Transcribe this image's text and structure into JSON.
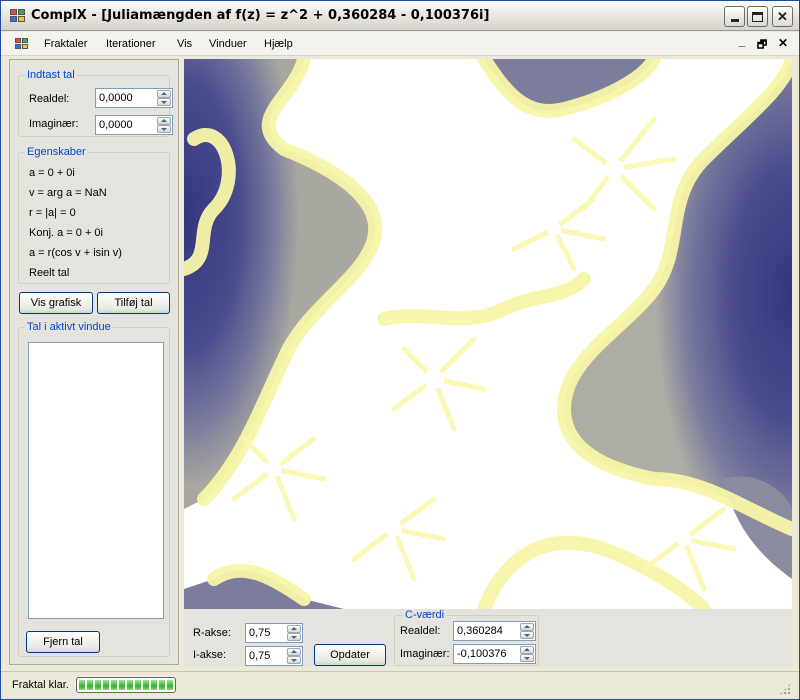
{
  "window": {
    "title": "ComplX - [Juliamængden af f(z) = z^2 + 0,360284 - 0,100376i]",
    "controls": {
      "minimize": "minimize",
      "maximize": "maximize",
      "close": "✕"
    }
  },
  "menu": {
    "items": [
      "Fraktaler",
      "Iterationer",
      "Vis",
      "Vinduer",
      "Hjælp"
    ],
    "mdi": {
      "minimize": "_",
      "restore": "🗗",
      "close": "✕"
    }
  },
  "input_group": {
    "legend": "Indtast tal",
    "real_label": "Realdel:",
    "real_value": "0,0000",
    "imag_label": "Imaginær:",
    "imag_value": "0,0000"
  },
  "properties_group": {
    "legend": "Egenskaber",
    "lines": [
      "a = 0 + 0i",
      "v = arg a = NaN",
      "r = |a| = 0",
      "Konj. a = 0 + 0i",
      "a = r(cos v + isin v)",
      "Reelt tal"
    ]
  },
  "buttons": {
    "show_graphic": "Vis grafisk",
    "add_number": "Tilføj tal",
    "remove_number": "Fjern tal",
    "update": "Opdater"
  },
  "active_window_group": {
    "legend": "Tal i aktivt vindue",
    "items": []
  },
  "axes": {
    "r_label": "R-akse:",
    "r_value": "0,75",
    "i_label": "I-akse:",
    "i_value": "0,75"
  },
  "c_value_group": {
    "legend": "C-værdi",
    "real_label": "Realdel:",
    "real_value": "0,360284",
    "imag_label": "Imaginær:",
    "imag_value": "-0,100376"
  },
  "status": {
    "text": "Fraktal klar.",
    "progress": 1.0
  },
  "colors": {
    "fractal_background": "#34357f",
    "fractal_set": "#ffffff",
    "fractal_edge": "#f8f6a8",
    "legend_text": "#0046d5"
  }
}
